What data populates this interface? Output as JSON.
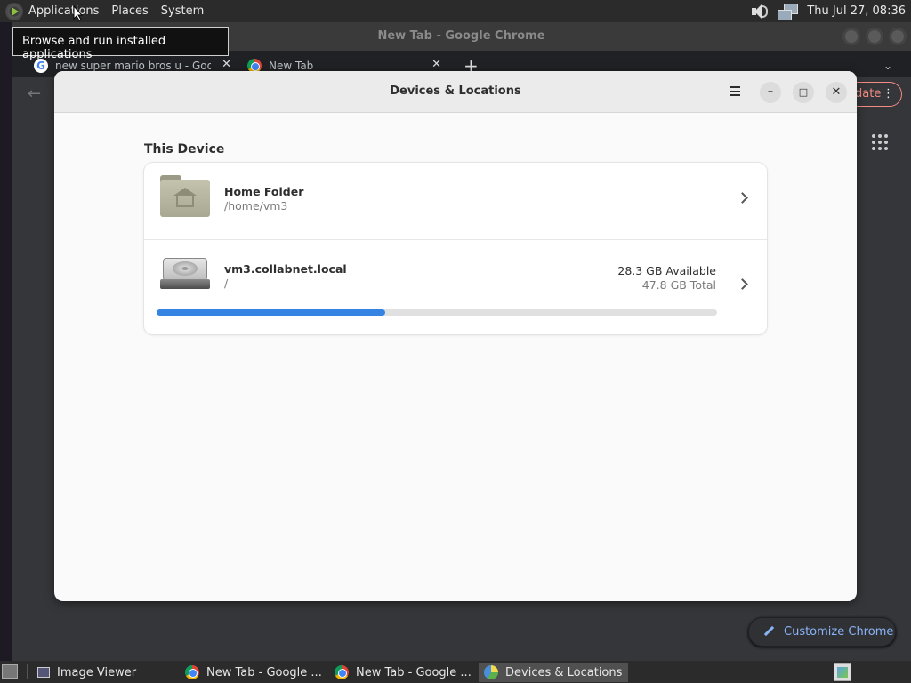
{
  "top_panel": {
    "menus": [
      "Applications",
      "Places",
      "System"
    ],
    "clock": "Thu Jul 27, 08:36"
  },
  "tooltip": "Browse and run installed applications",
  "chrome": {
    "window_title": "New Tab - Google Chrome",
    "tabs": [
      {
        "label": "new super mario bros u - Goog"
      },
      {
        "label": "New Tab"
      }
    ],
    "new_tab_symbol": "+",
    "update_label": "date",
    "customize_label": "Customize Chrome"
  },
  "dialog": {
    "title": "Devices & Locations",
    "section_title": "This Device",
    "home": {
      "name": "Home Folder",
      "path": "/home/vm3"
    },
    "drive": {
      "name": "vm3.collabnet.local",
      "path": "/",
      "available": "28.3 GB Available",
      "total": "47.8 GB Total",
      "used_fraction": 0.408
    },
    "accent_color": "#3584e4"
  },
  "taskbar": {
    "items": [
      "Image Viewer",
      "New Tab - Google ...",
      "New Tab - Google ...",
      "Devices & Locations"
    ]
  }
}
